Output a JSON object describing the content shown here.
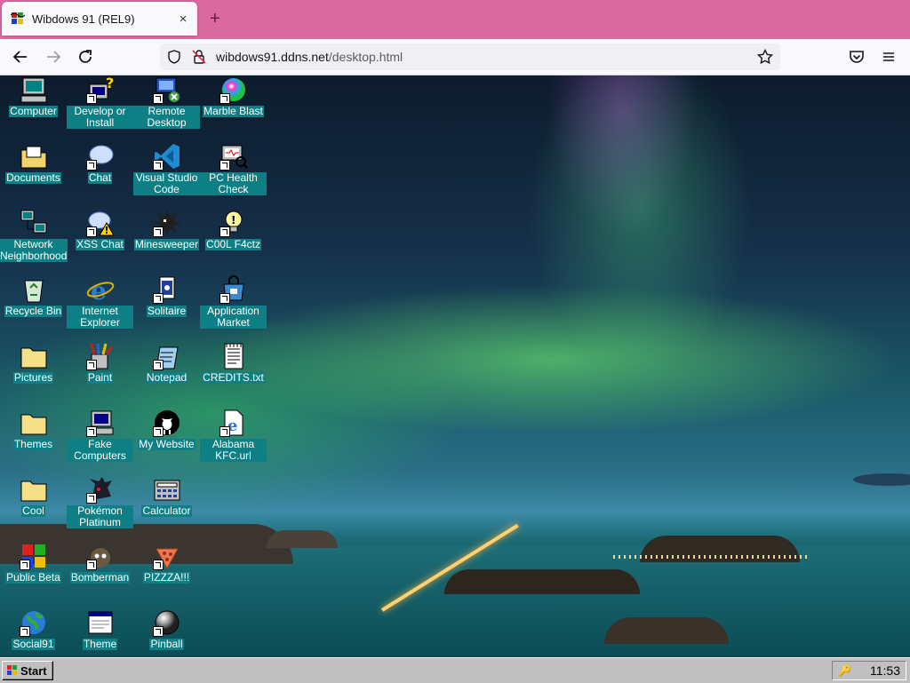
{
  "browser": {
    "tab_title": "Wibdows 91 (REL9)",
    "tab_close": "×",
    "new_tab": "+",
    "url_host": "wibdows91.ddns.net",
    "url_path": "/desktop.html"
  },
  "desktop": {
    "icons": [
      {
        "label": "Computer",
        "icon": "computer-icon"
      },
      {
        "label": "Develop or Install",
        "icon": "develop-install-icon"
      },
      {
        "label": "Remote Desktop",
        "icon": "remote-desktop-icon"
      },
      {
        "label": "Marble Blast",
        "icon": "marble-blast-icon"
      },
      {
        "label": "Documents",
        "icon": "documents-folder-icon"
      },
      {
        "label": "Chat",
        "icon": "chat-icon"
      },
      {
        "label": "Visual Studio Code",
        "icon": "vscode-icon"
      },
      {
        "label": "PC Health Check",
        "icon": "pc-health-check-icon"
      },
      {
        "label": "Network Neighborhood",
        "icon": "network-neighborhood-icon"
      },
      {
        "label": "XSS Chat",
        "icon": "xss-chat-icon"
      },
      {
        "label": "Minesweeper",
        "icon": "minesweeper-icon"
      },
      {
        "label": "C00L F4ctz",
        "icon": "cool-facts-icon"
      },
      {
        "label": "Recycle Bin",
        "icon": "recycle-bin-icon"
      },
      {
        "label": "Internet Explorer",
        "icon": "internet-explorer-icon"
      },
      {
        "label": "Solitaire",
        "icon": "solitaire-icon"
      },
      {
        "label": "Application Market",
        "icon": "application-market-icon"
      },
      {
        "label": "Pictures",
        "icon": "pictures-folder-icon"
      },
      {
        "label": "Paint",
        "icon": "paint-icon"
      },
      {
        "label": "Notepad",
        "icon": "notepad-icon"
      },
      {
        "label": "CREDITS.txt",
        "icon": "text-file-icon"
      },
      {
        "label": "Themes",
        "icon": "themes-folder-icon"
      },
      {
        "label": "Fake Computers",
        "icon": "fake-computers-icon"
      },
      {
        "label": "My Website",
        "icon": "github-icon"
      },
      {
        "label": "Alabama KFC.url",
        "icon": "url-shortcut-icon"
      },
      {
        "label": "Cool",
        "icon": "cool-folder-icon"
      },
      {
        "label": "Pokémon Platinum",
        "icon": "pokemon-icon"
      },
      {
        "label": "Calculator",
        "icon": "calculator-icon"
      },
      {
        "label": "Public Beta",
        "icon": "public-beta-icon"
      },
      {
        "label": "Bomberman",
        "icon": "bomberman-icon"
      },
      {
        "label": "PIZZZA!!!",
        "icon": "pizza-icon"
      },
      {
        "label": "Social91",
        "icon": "social91-icon"
      },
      {
        "label": "Theme",
        "icon": "theme-window-icon"
      },
      {
        "label": "Pinball",
        "icon": "pinball-icon"
      }
    ]
  },
  "taskbar": {
    "start_label": "Start",
    "clock": "11:53"
  }
}
